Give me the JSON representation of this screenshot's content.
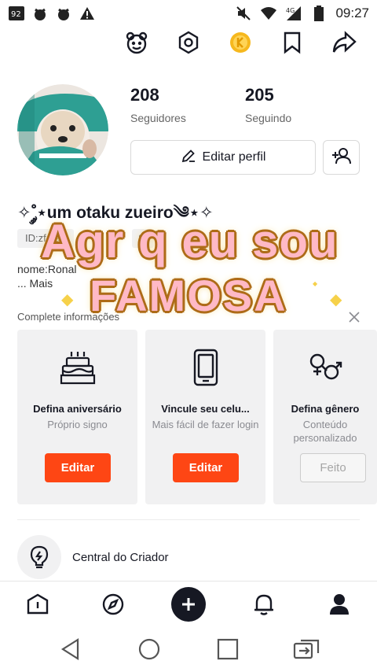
{
  "status_bar": {
    "time": "09:27",
    "network": "4G",
    "left_icons": [
      "notification-badge-icon",
      "app-notification-icon",
      "app-notification-icon",
      "warning-icon"
    ],
    "right_icons": [
      "mute-icon",
      "wifi-icon",
      "signal-icon",
      "battery-icon"
    ]
  },
  "top_icons": [
    "face-icon",
    "settings-hex-icon",
    "coin-icon",
    "bookmark-icon",
    "share-icon"
  ],
  "profile": {
    "followers_count": "208",
    "followers_label": "Seguidores",
    "following_count": "205",
    "following_label": "Seguindo",
    "edit_profile_label": "Editar perfil",
    "nickname": "✧˚༘⋆um otaku zueiro༄⋆✧",
    "id_text": "ID:zf...92",
    "id_extra": "Si",
    "bio_line1": "nome:Ronal",
    "bio_line2": "...  Mais"
  },
  "overlay_text": {
    "line1": "Agr q eu sou",
    "line2": "FAMOSA"
  },
  "complete_info": {
    "header": "Complete informações",
    "cards": [
      {
        "icon": "cake-icon",
        "title": "Defina aniversário",
        "subtitle": "Próprio signo",
        "button": "Editar",
        "state": "active"
      },
      {
        "icon": "phone-icon",
        "title": "Vincule seu celu...",
        "subtitle": "Mais fácil de fazer  login",
        "button": "Editar",
        "state": "active"
      },
      {
        "icon": "gender-icon",
        "title": "Defina gênero",
        "subtitle": "Conteúdo personalizado",
        "button": "Feito",
        "state": "done"
      }
    ]
  },
  "creator_center": {
    "label": "Central do Criador",
    "icon": "lightbulb-icon"
  },
  "bottom_nav": [
    "home-icon",
    "discover-icon",
    "plus-icon",
    "inbox-bell-icon",
    "profile-icon"
  ],
  "colors": {
    "accent": "#fe4614",
    "text": "#161823",
    "muted": "#8a8b91",
    "card_bg": "#f1f1f2"
  }
}
